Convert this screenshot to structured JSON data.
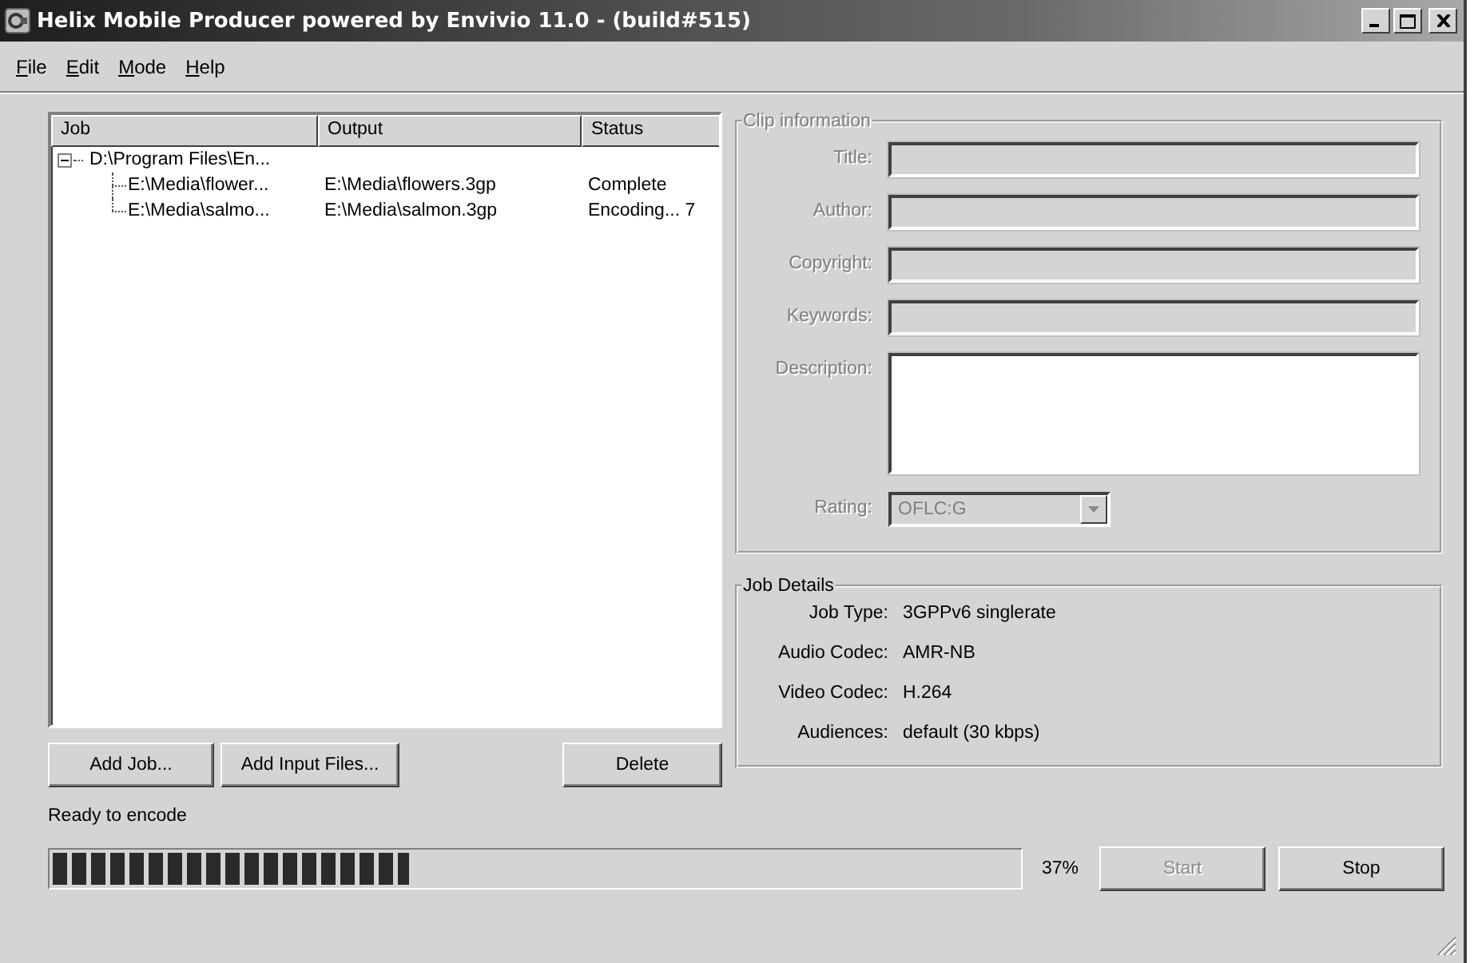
{
  "window": {
    "title": "Helix Mobile Producer powered by Envivio 11.0 - (build#515)"
  },
  "menu": [
    "File",
    "Edit",
    "Mode",
    "Help"
  ],
  "job_list": {
    "columns": [
      "Job",
      "Output",
      "Status"
    ],
    "rows": [
      {
        "job": "D:\\Program Files\\En...",
        "expanded": true,
        "children": [
          {
            "job": "E:\\Media\\flower...",
            "output": "E:\\Media\\flowers.3gp",
            "status": "Complete"
          },
          {
            "job": "E:\\Media\\salmo...",
            "output": "E:\\Media\\salmon.3gp",
            "status": "Encoding... 7"
          }
        ]
      }
    ]
  },
  "job_buttons": [
    {
      "label": "Add Job..."
    },
    {
      "label": "Add Input Files..."
    },
    {
      "label": "Delete"
    }
  ],
  "clip_information": {
    "title": "Clip information",
    "disabled": true,
    "fields": [
      {
        "label": "Title:",
        "kind": "text",
        "disabled": true
      },
      {
        "label": "Author:",
        "kind": "text",
        "disabled": true
      },
      {
        "label": "Copyright:",
        "kind": "text",
        "disabled": true
      },
      {
        "label": "Keywords:",
        "kind": "text",
        "disabled": true
      },
      {
        "label": "Description:",
        "kind": "textarea",
        "disabled": false
      },
      {
        "label": "Rating:",
        "kind": "dropdown",
        "value": "OFLC:G",
        "disabled": true
      }
    ]
  },
  "job_details": {
    "title": "Job Details",
    "rows": [
      {
        "label": "Job Type:",
        "value": "3GPPv6 singlerate"
      },
      {
        "label": "Audio Codec:",
        "value": "AMR-NB"
      },
      {
        "label": "Video Codec:",
        "value": "H.264"
      },
      {
        "label": "Audiences:",
        "value": "default (30 kbps)"
      }
    ]
  },
  "status_text": "Ready to encode",
  "progress": {
    "level": 0.37,
    "reading": "37%"
  },
  "action_buttons": [
    {
      "label": "Start",
      "disabled": true
    },
    {
      "label": "Stop",
      "disabled": false
    }
  ]
}
